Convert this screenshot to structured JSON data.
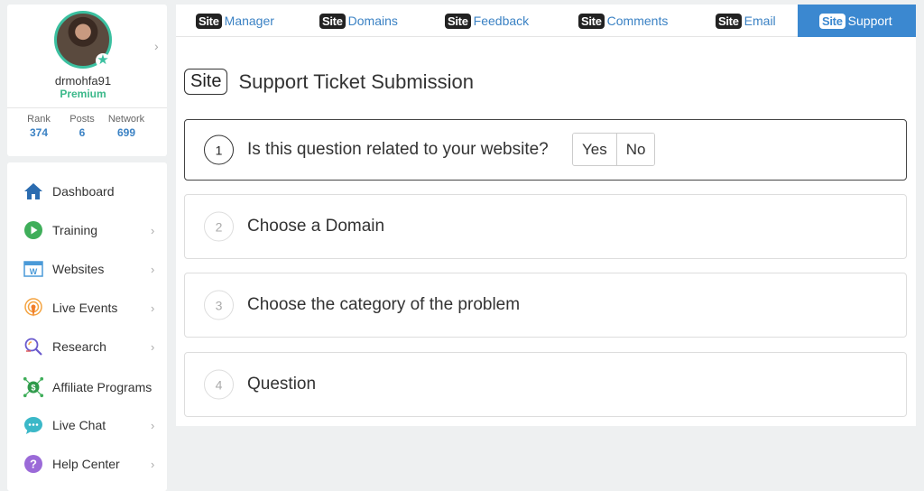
{
  "profile": {
    "username": "drmohfa91",
    "membership": "Premium",
    "stats": [
      {
        "label": "Rank",
        "value": "374"
      },
      {
        "label": "Posts",
        "value": "6"
      },
      {
        "label": "Network",
        "value": "699"
      }
    ]
  },
  "sidebar": {
    "items": [
      {
        "label": "Dashboard",
        "icon": "home-icon",
        "has_chevron": false
      },
      {
        "label": "Training",
        "icon": "play-icon",
        "has_chevron": true
      },
      {
        "label": "Websites",
        "icon": "website-icon",
        "has_chevron": true
      },
      {
        "label": "Live Events",
        "icon": "broadcast-icon",
        "has_chevron": true
      },
      {
        "label": "Research",
        "icon": "research-icon",
        "has_chevron": true
      },
      {
        "label": "Affiliate Programs",
        "icon": "affiliate-icon",
        "has_chevron": false
      },
      {
        "label": "Live Chat",
        "icon": "chat-icon",
        "has_chevron": true
      },
      {
        "label": "Help Center",
        "icon": "help-icon",
        "has_chevron": true
      }
    ]
  },
  "tabs": [
    {
      "badge": "Site",
      "label": "Manager"
    },
    {
      "badge": "Site",
      "label": "Domains"
    },
    {
      "badge": "Site",
      "label": "Feedback"
    },
    {
      "badge": "Site",
      "label": "Comments"
    },
    {
      "badge": "Site",
      "label": "Email"
    },
    {
      "badge": "Site",
      "label": "Support",
      "active": true
    }
  ],
  "main": {
    "heading_badge": "Site",
    "heading_title": "Support Ticket Submission",
    "steps": [
      {
        "number": "1",
        "text": "Is this question related to your website?",
        "active": true,
        "options": [
          "Yes",
          "No"
        ]
      },
      {
        "number": "2",
        "text": "Choose a Domain"
      },
      {
        "number": "3",
        "text": "Choose the category of the problem"
      },
      {
        "number": "4",
        "text": "Question"
      }
    ]
  },
  "colors": {
    "accent": "#3b88d0",
    "link": "#3b82c4",
    "premium": "#3bb88a",
    "avatar_ring": "#3bc0a0"
  }
}
